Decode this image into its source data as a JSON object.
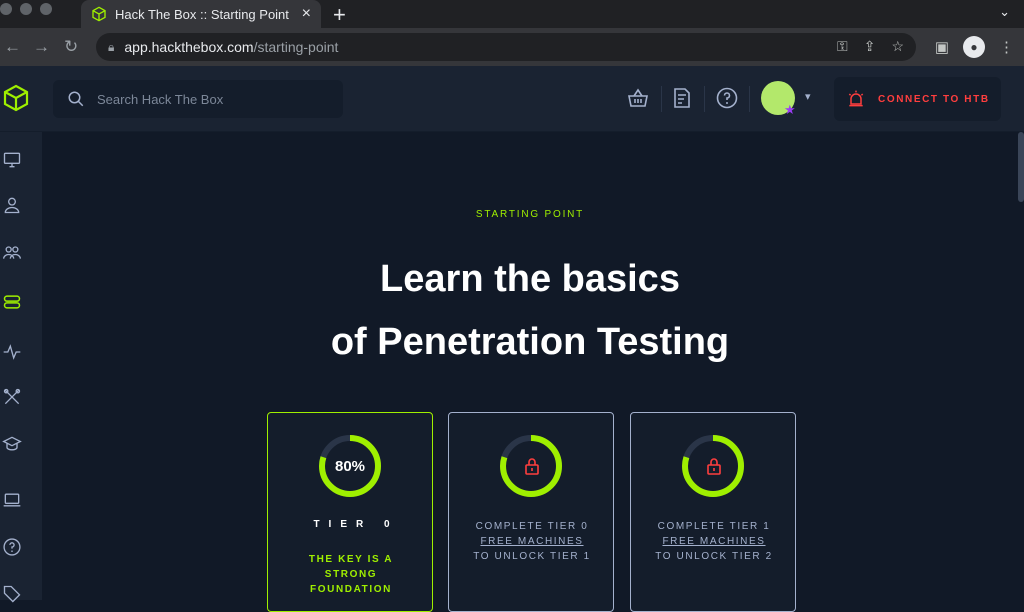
{
  "browser": {
    "tab_title": "Hack The Box :: Starting Point",
    "url_domain": "app.hackthebox.com",
    "url_path": "/starting-point"
  },
  "header": {
    "search_placeholder": "Search Hack The Box",
    "connect_label": "CONNECT TO HTB"
  },
  "hero": {
    "kicker": "STARTING POINT",
    "headline_line1": "Learn the basics",
    "headline_line2": "of Penetration Testing"
  },
  "tiers": [
    {
      "progress_label": "80%",
      "progress": 0.8,
      "tier_label": "TIER 0",
      "tagline_1": "THE KEY IS A",
      "tagline_2": "STRONG",
      "tagline_3": "FOUNDATION",
      "locked": false
    },
    {
      "lock_line1": "COMPLETE TIER 0",
      "lock_link": "FREE MACHINES",
      "lock_line3": "TO UNLOCK TIER 1",
      "progress": 0.8,
      "locked": true
    },
    {
      "lock_line1": "COMPLETE TIER 1",
      "lock_link": "FREE MACHINES",
      "lock_line3": "TO UNLOCK TIER 2",
      "progress": 0.8,
      "locked": true
    }
  ],
  "colors": {
    "accent_green": "#9fef00",
    "danger_red": "#ff3e3e",
    "bg": "#111927",
    "panel": "#1a2332"
  }
}
